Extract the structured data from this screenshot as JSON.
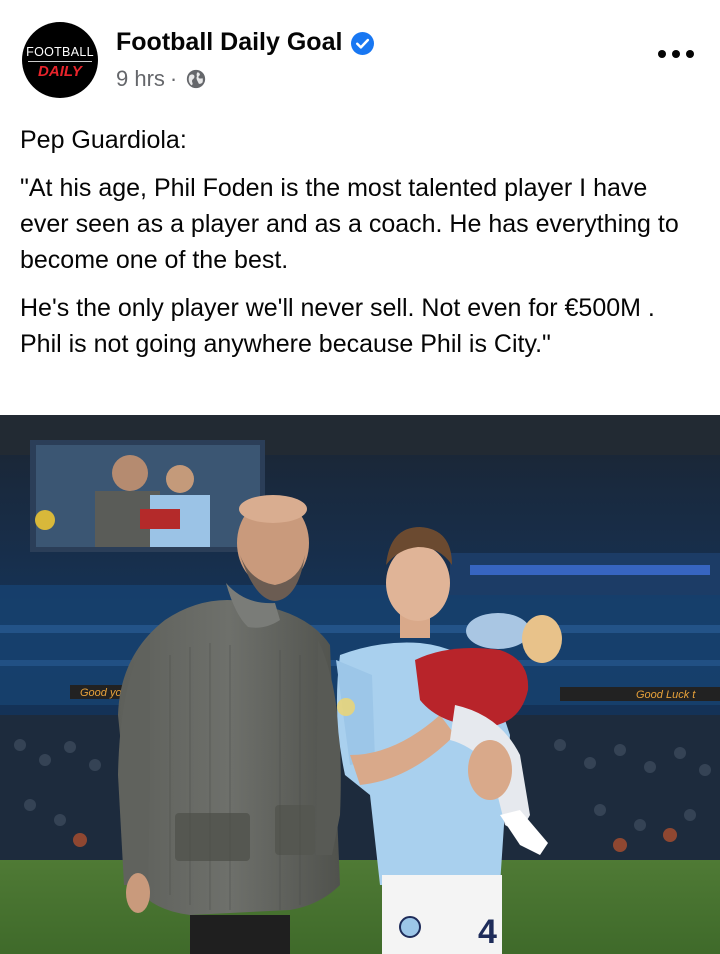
{
  "post": {
    "page_name": "Football Daily Goal",
    "time": "9 hrs",
    "separator": "·",
    "avatar": {
      "line1": "FOOTBALL",
      "line2": "DAILY"
    },
    "text": [
      "Pep Guardiola:",
      "\"At his age, Phil Foden is the most talented player I have ever seen as a player and as a coach. He has everything to become one of the best.",
      "He's the only player we'll never sell. Not even for €500M . Phil is not going anywhere because Phil is City.\""
    ],
    "photo": {
      "shirt_number": "4",
      "banner_left": "Good yo",
      "banner_right": "Good Luck t"
    }
  },
  "icons": {
    "verified": "verified-badge-icon",
    "audience": "globe-icon",
    "menu": "more-options-icon"
  },
  "colors": {
    "verified_blue": "#1877f2",
    "meta_grey": "#65676b",
    "text": "#050505"
  }
}
